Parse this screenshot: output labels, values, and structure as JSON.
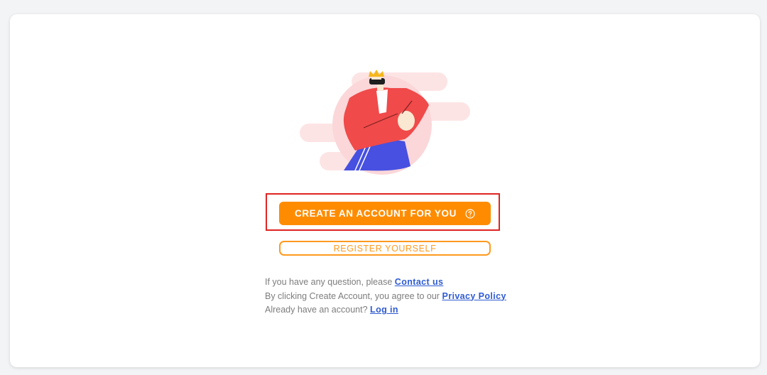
{
  "actions": {
    "create_account_label": "CREATE AN ACCOUNT FOR YOU",
    "register_label": "REGISTER YOURSELF"
  },
  "info": {
    "question_text": "If you have any question, please ",
    "contact_link": "Contact us",
    "agree_text": "By clicking Create Account, you agree to our ",
    "privacy_link": "Privacy Policy",
    "account_text": "Already have an account? ",
    "login_link": "Log in"
  },
  "icons": {
    "help": "question-circle-icon",
    "illustration": "person-with-crown-illustration"
  },
  "colors": {
    "primary": "#ff8c00",
    "outline": "#ff9a1f",
    "link": "#2f5bd3",
    "highlight": "#e02424"
  }
}
